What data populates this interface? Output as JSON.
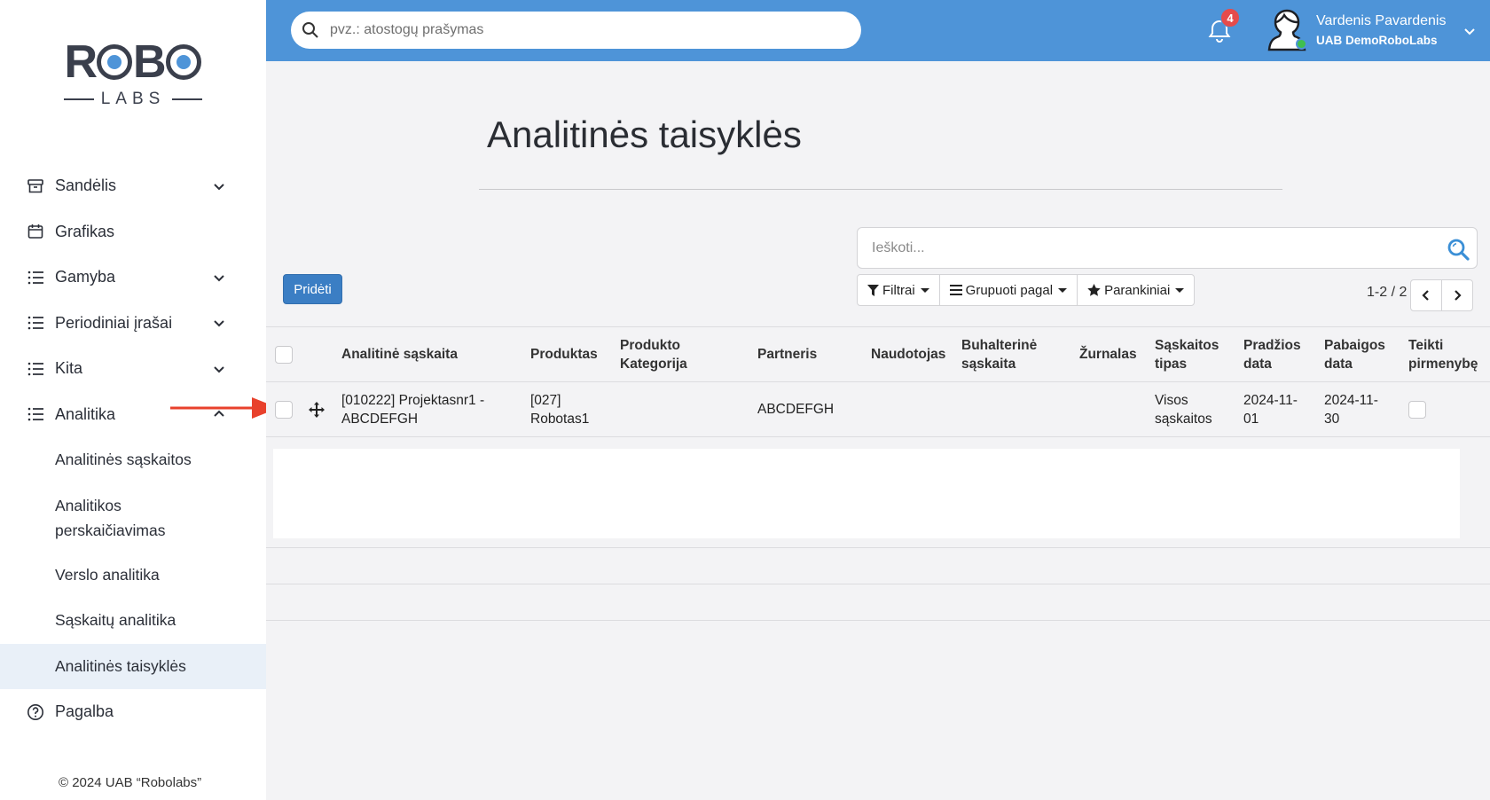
{
  "brand": {
    "logo_word": "ROBO",
    "logo_sub": "LABS"
  },
  "sidebar": {
    "items": [
      {
        "label": "Sandėlis",
        "icon": "archive-box-icon",
        "expandable": true,
        "expanded": false
      },
      {
        "label": "Grafikas",
        "icon": "calendar-icon",
        "expandable": false
      },
      {
        "label": "Gamyba",
        "icon": "list-icon",
        "expandable": true,
        "expanded": false
      },
      {
        "label": "Periodiniai įrašai",
        "icon": "list-icon",
        "expandable": true,
        "expanded": false
      },
      {
        "label": "Kita",
        "icon": "list-icon",
        "expandable": true,
        "expanded": false
      },
      {
        "label": "Analitika",
        "icon": "list-icon",
        "expandable": true,
        "expanded": true
      }
    ],
    "subitems": [
      {
        "label": "Analitinės sąskaitos"
      },
      {
        "label": "Analitikos perskaičiavimas"
      },
      {
        "label": "Verslo analitika"
      },
      {
        "label": "Sąskaitų analitika"
      },
      {
        "label": "Analitinės taisyklės",
        "active": true
      }
    ],
    "help": {
      "label": "Pagalba",
      "icon": "question-circle-icon"
    },
    "copyright": "© 2024 UAB “Robolabs”"
  },
  "topbar": {
    "search_placeholder": "pvz.: atostogų prašymas",
    "notifications_count": "4",
    "user_name": "Vardenis Pavardenis",
    "user_company": "UAB DemoRoboLabs",
    "accent": "#4e94d8"
  },
  "page": {
    "title": "Analitinės taisyklės",
    "search_placeholder": "Ieškoti...",
    "add_button": "Pridėti",
    "filters": "Filtrai",
    "group_by": "Grupuoti pagal",
    "favorites": "Parankiniai",
    "pager": "1-2 / 2"
  },
  "table": {
    "columns": [
      "Analitinė sąskaita",
      "Produktas",
      "Produkto Kategorija",
      "Partneris",
      "Naudotojas",
      "Buhalterinė sąskaita",
      "Žurnalas",
      "Sąskaitos tipas",
      "Pradžios data",
      "Pabaigos data",
      "Teikti pirmenybę"
    ],
    "rows": [
      {
        "analitine_saskaita": "[010222] Projektasnr1 - ABCDEFGH",
        "produktas": "[027] Robotas1",
        "produkto_kategorija": "",
        "partneris": "ABCDEFGH",
        "naudotojas": "",
        "buhalterine_saskaita": "",
        "zurnalas": "",
        "saskaitos_tipas": "Visos sąskaitos",
        "pradzios_data": "2024-11-01",
        "pabaigos_data": "2024-11-30",
        "teikti_pirmenybe": false
      }
    ]
  },
  "annotation": {
    "arrow_color": "#e8412c"
  }
}
